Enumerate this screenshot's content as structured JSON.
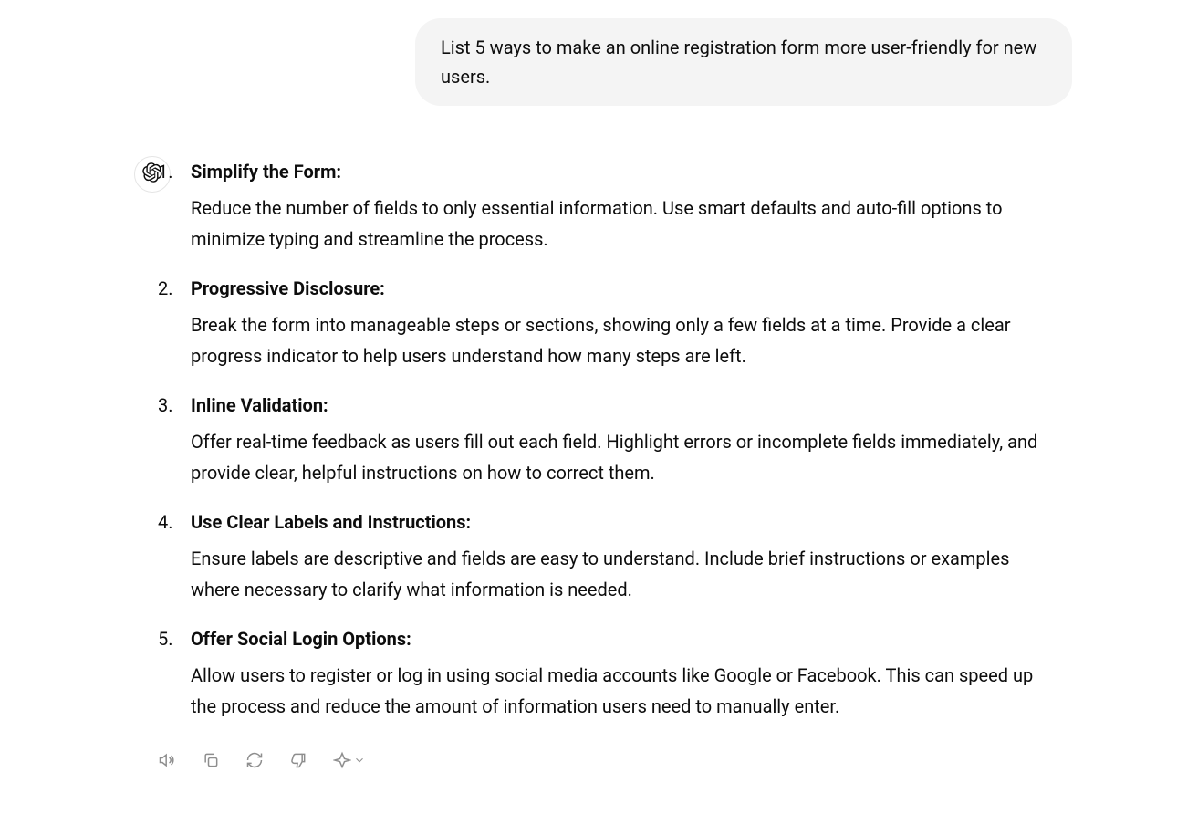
{
  "user_message": {
    "text": "List 5 ways to make an online registration form more user-friendly for new users."
  },
  "assistant_message": {
    "items": [
      {
        "title": "Simplify the Form:",
        "body": "Reduce the number of fields to only essential information. Use smart defaults and auto-fill options to minimize typing and streamline the process."
      },
      {
        "title": "Progressive Disclosure:",
        "body": "Break the form into manageable steps or sections, showing only a few fields at a time. Provide a clear progress indicator to help users understand how many steps are left."
      },
      {
        "title": "Inline Validation:",
        "body": "Offer real-time feedback as users fill out each field. Highlight errors or incomplete fields immediately, and provide clear, helpful instructions on how to correct them."
      },
      {
        "title": "Use Clear Labels and Instructions:",
        "body": "Ensure labels are descriptive and fields are easy to understand. Include brief instructions or examples where necessary to clarify what information is needed."
      },
      {
        "title": "Offer Social Login Options:",
        "body": "Allow users to register or log in using social media accounts like Google or Facebook. This can speed up the process and reduce the amount of information users need to manually enter."
      }
    ]
  }
}
